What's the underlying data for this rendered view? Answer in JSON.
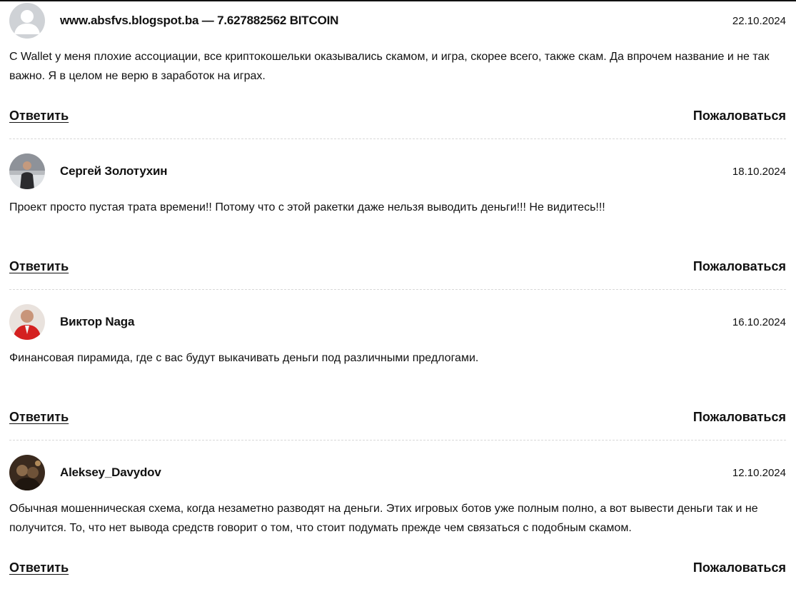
{
  "comments": [
    {
      "author": "www.absfvs.blogspot.ba — 7.627882562 BITCOIN",
      "date": "22.10.2024",
      "text": "С Wallet у меня плохие ассоциации, все криптокошельки оказывались скамом, и игра, скорее всего, также скам. Да впрочем название и не так важно. Я в целом не верю в заработок на играх.",
      "reply_label": "Ответить",
      "report_label": "Пожаловаться",
      "avatar": "default-user-icon"
    },
    {
      "author": "Сергей Золотухин",
      "date": "18.10.2024",
      "text": "Проект просто пустая трата времени!! Потому что с этой ракетки даже нельзя выводить деньги!!! Не видитесь!!!",
      "reply_label": "Ответить",
      "report_label": "Пожаловаться",
      "avatar": "user-photo"
    },
    {
      "author": "Виктор Naga",
      "date": "16.10.2024",
      "text": "Финансовая пирамида, где с вас будут выкачивать деньги под различными предлогами.",
      "reply_label": "Ответить",
      "report_label": "Пожаловаться",
      "avatar": "user-photo"
    },
    {
      "author": "Aleksey_Davydov",
      "date": "12.10.2024",
      "text": "Обычная мошенническая схема, когда незаметно разводят на деньги. Этих игровых ботов уже полным полно, а вот вывести деньги так и не получится. То, что нет вывода средств говорит о том, что стоит подумать прежде чем связаться с подобным скамом.",
      "reply_label": "Ответить",
      "report_label": "Пожаловаться",
      "avatar": "user-photo"
    }
  ]
}
